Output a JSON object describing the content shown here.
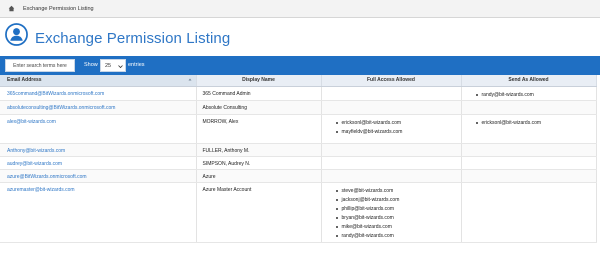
{
  "breadcrumb": {
    "label": "Exchange Permission Listing"
  },
  "header": {
    "title": "Exchange Permission Listing"
  },
  "toolbar": {
    "search_placeholder": "Enter search terms here",
    "show_label": "Show",
    "entries_value": "25",
    "entries_label": "entries"
  },
  "table": {
    "columns": [
      "Email Address",
      "Display Name",
      "Full Access Allowed",
      "Send As Allowed"
    ],
    "rows": [
      {
        "email": "365command@BitWizards.onmicrosoft.com",
        "display_name": "365 Command Admin",
        "full_access": [],
        "send_as": [
          "randy@bit-wizards.com"
        ]
      },
      {
        "email": "absoluteconsulting@BitWizards.onmicrosoft.com",
        "display_name": "Absolute Consulting",
        "full_access": [],
        "send_as": []
      },
      {
        "email": "alex@bit-wizards.com",
        "display_name": "MORROW, Alex",
        "full_access": [
          "ericksonl@bit-wizards.com",
          "mayfieldv@bit-wizards.com"
        ],
        "send_as": [
          "ericksonl@bit-wizards.com"
        ]
      },
      {
        "email": "Anthony@bit-wizards.com",
        "display_name": "FULLER, Anthony M.",
        "full_access": [],
        "send_as": []
      },
      {
        "email": "audrey@bit-wizards.com",
        "display_name": "SIMPSON, Audrey N.",
        "full_access": [],
        "send_as": []
      },
      {
        "email": "azure@BitWizards.onmicrosoft.com",
        "display_name": "Azure",
        "full_access": [],
        "send_as": []
      },
      {
        "email": "azuremaster@bit-wizards.com",
        "display_name": "Azure Master Account",
        "full_access": [
          "steve@bit-wizards.com",
          "jacksonj@bit-wizards.com",
          "phillip@bit-wizards.com",
          "bryan@bit-wizards.com",
          "mike@bit-wizards.com",
          "randy@bit-wizards.com"
        ],
        "send_as": []
      }
    ]
  },
  "colors": {
    "accent": "#1f6fc3",
    "title": "#2f77c6",
    "link": "#2f77c6",
    "header_bg": "#e9eef5"
  },
  "icons": {
    "home": "home-icon",
    "avatar": "user-avatar-icon",
    "sort": "sort-icon",
    "dropdown": "chevron-down-icon"
  }
}
